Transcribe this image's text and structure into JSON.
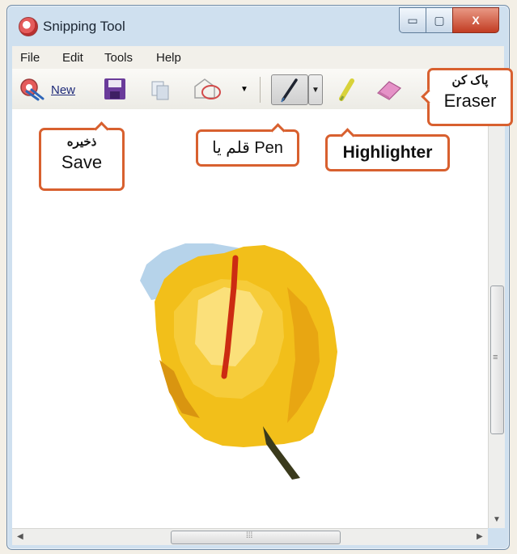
{
  "window": {
    "title": "Snipping Tool"
  },
  "title_buttons": {
    "minimize": "▭",
    "maximize": "▢",
    "close": "X"
  },
  "menu": [
    "File",
    "Edit",
    "Tools",
    "Help"
  ],
  "toolbar": {
    "new_label": "New"
  },
  "callouts": {
    "save": {
      "fa": "ذخیره",
      "en": "Save"
    },
    "pen": {
      "text": "قلم یا Pen"
    },
    "highlighter": {
      "text": "Highlighter"
    },
    "eraser": {
      "fa": "پاک کن",
      "en": "Eraser"
    }
  },
  "scrollbar": {
    "h_grip": "⁞⁞⁞",
    "v_grip": "≡"
  },
  "colors": {
    "accent": "#d8602f",
    "tulip_yellow": "#f2bf1a",
    "tulip_red_stripe": "#cc2b12",
    "sky_blue": "#b6d3ea"
  }
}
